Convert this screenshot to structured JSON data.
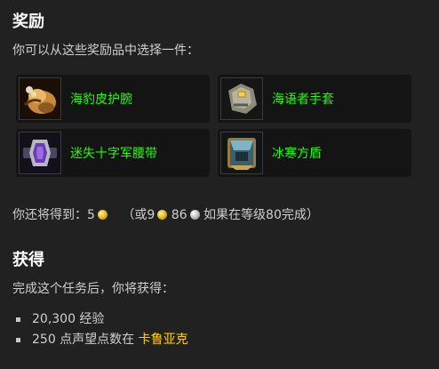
{
  "rewards": {
    "title": "奖励",
    "intro": "你可以从这些奖励品中选择一件：",
    "items": [
      {
        "name": "海豹皮护腕",
        "icon": "fur-bracers-icon"
      },
      {
        "name": "海语者手套",
        "icon": "stone-gauntlets-icon"
      },
      {
        "name": "迷失十字军腰带",
        "icon": "purple-belt-icon"
      },
      {
        "name": "冰寒方盾",
        "icon": "frost-shield-icon"
      }
    ],
    "money": {
      "prefix": "你还将得到：",
      "gold": "5",
      "alt_open": "（或",
      "alt_gold": "9",
      "alt_silver": "86",
      "alt_suffix": "如果在等级80完成）"
    }
  },
  "gains": {
    "title": "获得",
    "intro": "完成这个任务后，你将获得：",
    "xp": "20,300 经验",
    "rep_prefix": "250 点声望点数在",
    "rep_faction": "卡鲁亚克"
  },
  "colors": {
    "background": "#212121",
    "item_uncommon": "#1eff00",
    "faction_link": "#ffd100",
    "gold_coin": "#e0b319",
    "silver_coin": "#b9b9b9"
  }
}
